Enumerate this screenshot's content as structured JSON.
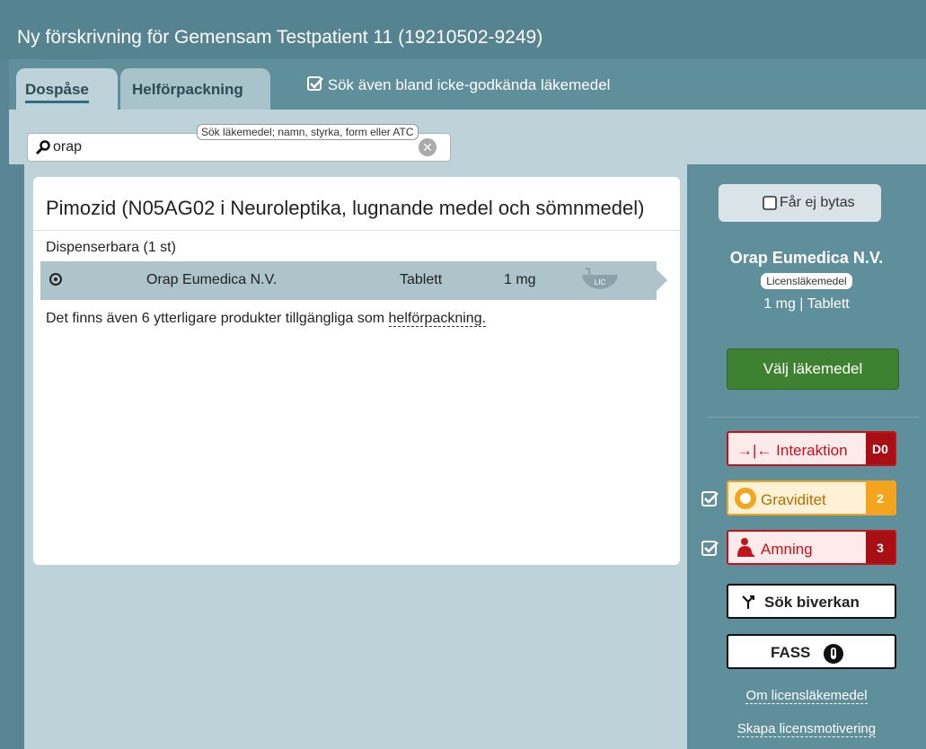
{
  "window": {
    "title": "Ny förskrivning för Gemensam Testpatient 11 (19210502-9249)"
  },
  "tabs": [
    {
      "label": "Dospåse",
      "active": true
    },
    {
      "label": "Helförpackning",
      "active": false
    }
  ],
  "filter": {
    "label": "Sök även bland icke-godkända läkemedel",
    "checked": true
  },
  "search": {
    "value": "orap",
    "tooltip": "Sök läkemedel; namn, styrka, form eller ATC"
  },
  "result": {
    "heading": "Pimozid (N05AG02 i Neuroleptika, lugnande medel och sömnmedel)",
    "group_label": "Dispenserbara (1 st)",
    "rows": [
      {
        "name": "Orap Eumedica N.V.",
        "form": "Tablett",
        "strength": "1 mg",
        "badge": "LIC"
      }
    ],
    "note_prefix": "Det finns även 6 ytterligare produkter tillgängliga som ",
    "note_link": "helförpackning."
  },
  "sidebar": {
    "no_swap_label": "Får ej bytas",
    "product_name": "Orap Eumedica N.V.",
    "product_badge": "Licensläkemedel",
    "product_dose": "1 mg | Tablett",
    "choose_label": "Välj läkemedel",
    "warnings": [
      {
        "label": "Interaktion",
        "badge": "D0",
        "checked": false
      },
      {
        "label": "Graviditet",
        "badge": "2",
        "checked": true
      },
      {
        "label": "Amning",
        "badge": "3",
        "checked": true
      }
    ],
    "side_effect_label": "Sök biverkan",
    "fass_label": "FASS",
    "link_about": "Om licensläkemedel",
    "link_create": "Skapa licensmotivering"
  },
  "colors": {
    "header": "#55838f",
    "panel": "#bdd2d9",
    "accent_green": "#3e8131",
    "danger": "#c2131b",
    "warning": "#f5a41f"
  }
}
